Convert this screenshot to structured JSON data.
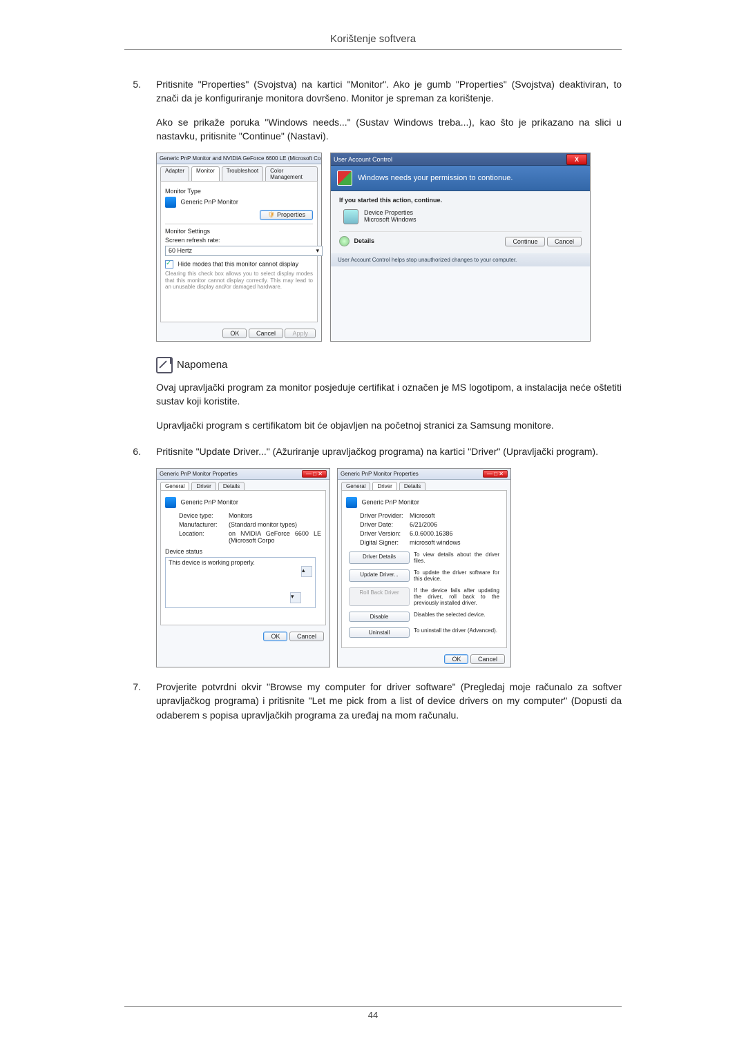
{
  "header": {
    "title": "Korištenje softvera"
  },
  "footer": {
    "page_number": "44"
  },
  "steps": {
    "s5": {
      "num": "5.",
      "p1": "Pritisnite \"Properties\" (Svojstva) na kartici \"Monitor\". Ako je gumb \"Properties\" (Svojstva) deaktiviran, to znači da je konfiguriranje monitora dovršeno. Monitor je spreman za korištenje.",
      "p2": "Ako se prikaže poruka \"Windows needs...\" (Sustav Windows treba...), kao što je prikazano na slici u nastavku, pritisnite \"Continue\" (Nastavi)."
    },
    "s6": {
      "num": "6.",
      "p1": "Pritisnite \"Update Driver...\" (Ažuriranje upravljačkog programa) na kartici \"Driver\" (Upravljački program)."
    },
    "s7": {
      "num": "7.",
      "p1": "Provjerite potvrdni okvir \"Browse my computer for driver software\" (Pregledaj moje računalo za softver upravljačkog programa) i pritisnite \"Let me pick from a list of device drivers on my computer\" (Dopusti da odaberem s popisa upravljačkih programa za uređaj na mom računalu."
    }
  },
  "note": {
    "title": "Napomena",
    "p1": "Ovaj upravljački program za monitor posjeduje certifikat i označen je MS logotipom, a instalacija neće oštetiti sustav koji koristite.",
    "p2": "Upravljački program s certifikatom bit će objavljen na početnoj stranici za Samsung monitore."
  },
  "monitor_dialog": {
    "title": "Generic PnP Monitor and NVIDIA GeForce 6600 LE (Microsoft Co...",
    "tabs": [
      "Adapter",
      "Monitor",
      "Troubleshoot",
      "Color Management"
    ],
    "mon_type_label": "Monitor Type",
    "mon_type_value": "Generic PnP Monitor",
    "properties_btn": "Properties",
    "settings_label": "Monitor Settings",
    "refresh_label": "Screen refresh rate:",
    "refresh_value": "60 Hertz",
    "hide_modes_check": "Hide modes that this monitor cannot display",
    "hide_modes_desc": "Clearing this check box allows you to select display modes that this monitor cannot display correctly. This may lead to an unusable display and/or damaged hardware.",
    "ok": "OK",
    "cancel": "Cancel",
    "apply": "Apply"
  },
  "uac_dialog": {
    "title": "User Account Control",
    "band": "Windows needs your permission to contionue.",
    "started": "If you started this action, continue.",
    "item_name": "Device Properties",
    "item_pub": "Microsoft Windows",
    "details": "Details",
    "continue_btn": "Continue",
    "cancel_btn": "Cancel",
    "helps_text": "User Account Control helps stop unauthorized changes to your computer.",
    "close_x": "X"
  },
  "drv_general": {
    "title": "Generic PnP Monitor Properties",
    "tabs": [
      "General",
      "Driver",
      "Details"
    ],
    "head": "Generic PnP Monitor",
    "devtype_l": "Device type:",
    "devtype_v": "Monitors",
    "manuf_l": "Manufacturer:",
    "manuf_v": "(Standard monitor types)",
    "loc_l": "Location:",
    "loc_v": "on NVIDIA GeForce 6600 LE (Microsoft Corpo",
    "status_l": "Device status",
    "status_v": "This device is working properly.",
    "ok": "OK",
    "cancel": "Cancel"
  },
  "drv_driver": {
    "title": "Generic PnP Monitor Properties",
    "tabs": [
      "General",
      "Driver",
      "Details"
    ],
    "head": "Generic PnP Monitor",
    "provider_l": "Driver Provider:",
    "provider_v": "Microsoft",
    "date_l": "Driver Date:",
    "date_v": "6/21/2006",
    "version_l": "Driver Version:",
    "version_v": "6.0.6000.16386",
    "signer_l": "Digital Signer:",
    "signer_v": "microsoft windows",
    "btn_details": "Driver Details",
    "btn_details_d": "To view details about the driver files.",
    "btn_update": "Update Driver...",
    "btn_update_d": "To update the driver software for this device.",
    "btn_rollback": "Roll Back Driver",
    "btn_rollback_d": "If the device fails after updating the driver, roll back to the previously installed driver.",
    "btn_disable": "Disable",
    "btn_disable_d": "Disables the selected device.",
    "btn_uninstall": "Uninstall",
    "btn_uninstall_d": "To uninstall the driver (Advanced).",
    "ok": "OK",
    "cancel": "Cancel"
  }
}
